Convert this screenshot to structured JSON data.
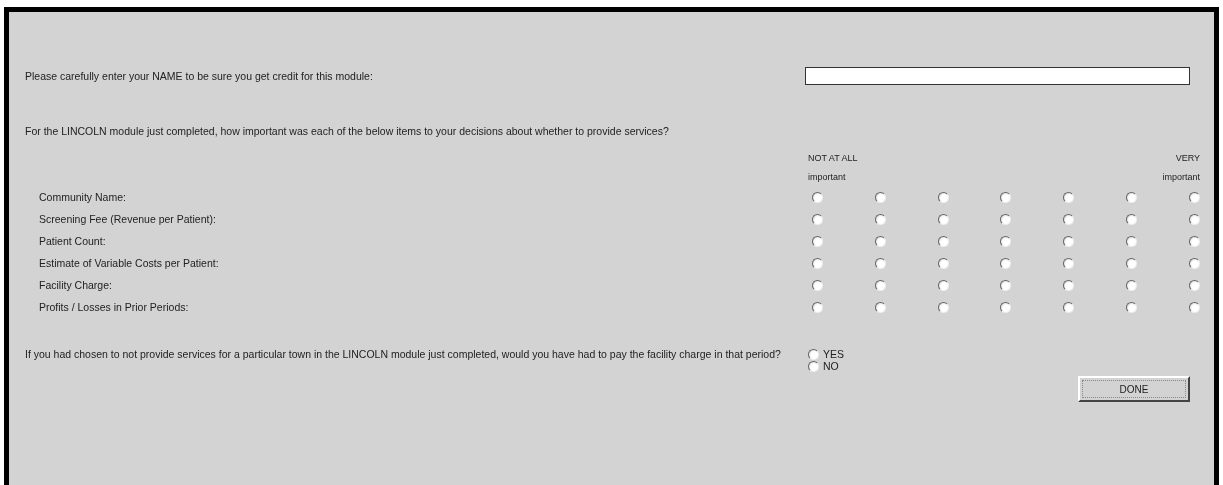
{
  "name_prompt": {
    "label": "Please carefully enter your NAME to be sure you get credit for this module:"
  },
  "question": "For the LINCOLN module just completed, how important was each of the below items to your decisions about whether to provide services?",
  "scale": {
    "low_top": "NOT AT ALL",
    "low_bottom": "important",
    "high_top": "VERY",
    "high_bottom": "important"
  },
  "items": [
    {
      "label": "Community Name:",
      "options": [
        {
          "selected": false
        },
        {
          "selected": false
        },
        {
          "selected": false
        },
        {
          "selected": false
        },
        {
          "selected": false
        },
        {
          "selected": false
        },
        {
          "selected": false
        }
      ]
    },
    {
      "label": "Screening Fee (Revenue per Patient):",
      "options": [
        {
          "selected": false
        },
        {
          "selected": false
        },
        {
          "selected": false
        },
        {
          "selected": false
        },
        {
          "selected": false
        },
        {
          "selected": false
        },
        {
          "selected": false
        }
      ]
    },
    {
      "label": "Patient Count:",
      "options": [
        {
          "selected": false
        },
        {
          "selected": false
        },
        {
          "selected": false
        },
        {
          "selected": false
        },
        {
          "selected": false
        },
        {
          "selected": false
        },
        {
          "selected": false
        }
      ]
    },
    {
      "label": "Estimate of Variable Costs per Patient:",
      "options": [
        {
          "selected": false
        },
        {
          "selected": false
        },
        {
          "selected": false
        },
        {
          "selected": false
        },
        {
          "selected": false
        },
        {
          "selected": false
        },
        {
          "selected": false
        }
      ]
    },
    {
      "label": "Facility Charge:",
      "options": [
        {
          "selected": false
        },
        {
          "selected": false
        },
        {
          "selected": false
        },
        {
          "selected": false
        },
        {
          "selected": false
        },
        {
          "selected": false
        },
        {
          "selected": false
        }
      ]
    },
    {
      "label": "Profits / Losses in Prior Periods:",
      "options": [
        {
          "selected": false
        },
        {
          "selected": false
        },
        {
          "selected": false
        },
        {
          "selected": false
        },
        {
          "selected": false
        },
        {
          "selected": false
        },
        {
          "selected": false
        }
      ]
    }
  ],
  "facility_question": {
    "text": "If you had chosen to not provide services for a particular town in the LINCOLN module just completed, would you have had to pay the facility charge in that period?",
    "options": [
      {
        "label": "YES",
        "selected": false
      },
      {
        "label": "NO",
        "selected": false
      }
    ]
  },
  "done_button": "DONE"
}
